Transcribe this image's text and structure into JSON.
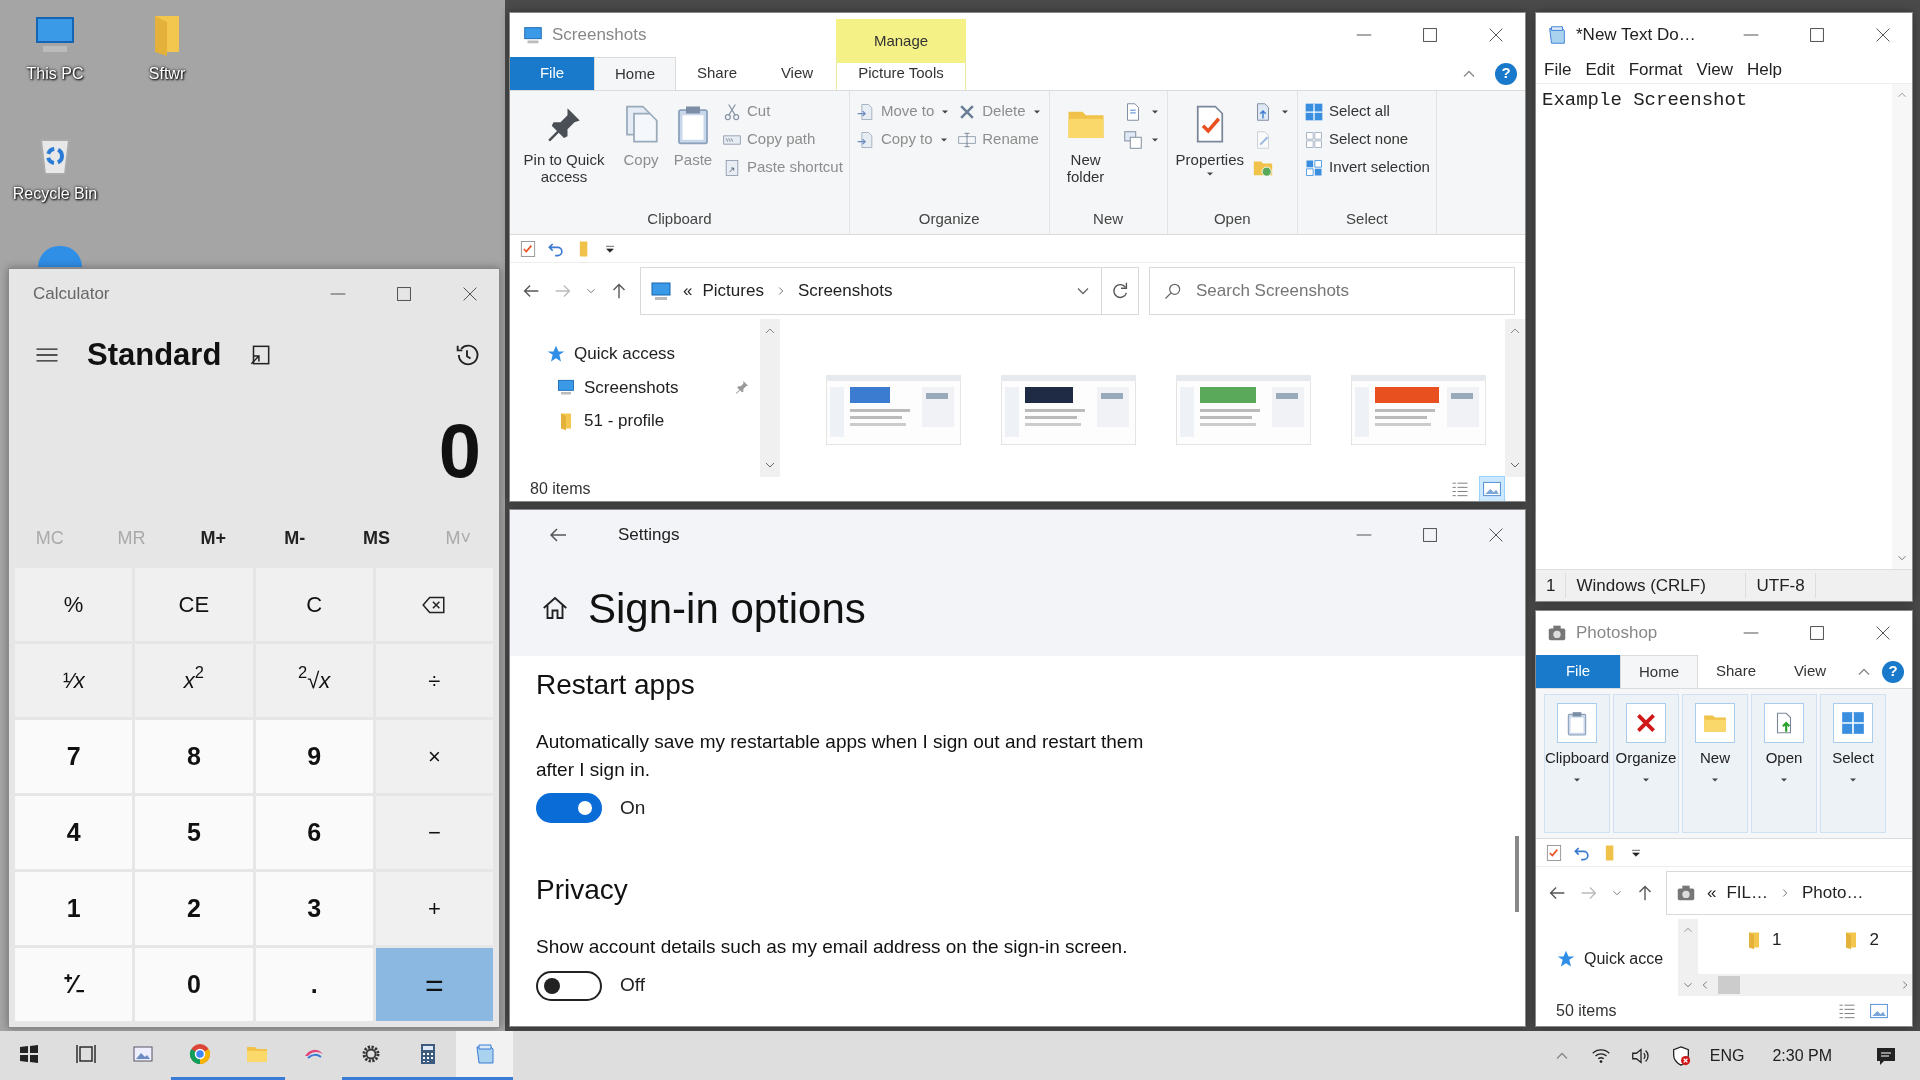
{
  "desktop": {
    "icons": [
      {
        "label": "This PC",
        "kind": "pc"
      },
      {
        "label": "Sftwr",
        "kind": "folder"
      },
      {
        "label": "Recycle Bin",
        "kind": "bin"
      }
    ]
  },
  "explorer": {
    "title": "Screenshots",
    "context_group": "Manage",
    "help": "?",
    "tabs": [
      {
        "label": "File",
        "kind": "file",
        "selected": false
      },
      {
        "label": "Home",
        "kind": "tab",
        "selected": true
      },
      {
        "label": "Share",
        "kind": "tab",
        "selected": false
      },
      {
        "label": "View",
        "kind": "tab",
        "selected": false
      },
      {
        "label": "Picture Tools",
        "kind": "context",
        "selected": false
      }
    ],
    "ribbon_groups": [
      {
        "label": "Clipboard",
        "columns": [
          [
            {
              "label": "Pin to Quick access",
              "kind": "large",
              "disabled": false,
              "dropdown": false
            }
          ],
          [
            {
              "label": "Copy",
              "kind": "large",
              "disabled": true,
              "dropdown": false
            }
          ],
          [
            {
              "label": "Paste",
              "kind": "large",
              "disabled": true,
              "dropdown": false
            }
          ],
          [
            {
              "label": "Cut",
              "kind": "small",
              "disabled": true,
              "dropdown": false
            },
            {
              "label": "Copy path",
              "kind": "small",
              "disabled": true,
              "dropdown": false
            },
            {
              "label": "Paste shortcut",
              "kind": "small",
              "disabled": true,
              "dropdown": false
            }
          ]
        ]
      },
      {
        "label": "Organize",
        "columns": [
          [
            {
              "label": "Move to",
              "kind": "small",
              "disabled": true,
              "dropdown": true
            },
            {
              "label": "Copy to",
              "kind": "small",
              "disabled": true,
              "dropdown": true
            }
          ],
          [
            {
              "label": "Delete",
              "kind": "small",
              "disabled": true,
              "dropdown": true
            },
            {
              "label": "Rename",
              "kind": "small",
              "disabled": true,
              "dropdown": false
            }
          ]
        ]
      },
      {
        "label": "New",
        "columns": [
          [
            {
              "label": "New folder",
              "kind": "large",
              "disabled": false,
              "dropdown": false
            }
          ],
          [
            {
              "kind": "icon",
              "disabled": false,
              "dropdown": true
            },
            {
              "kind": "icon",
              "disabled": false,
              "dropdown": true
            }
          ]
        ]
      },
      {
        "label": "Open",
        "columns": [
          [
            {
              "label": "Properties",
              "kind": "large",
              "disabled": false,
              "dropdown": true
            }
          ],
          [
            {
              "kind": "icon",
              "disabled": false,
              "dropdown": true
            },
            {
              "kind": "icon",
              "disabled": true,
              "dropdown": false
            },
            {
              "kind": "icon",
              "disabled": false,
              "dropdown": false
            }
          ]
        ]
      },
      {
        "label": "Select",
        "columns": [
          [
            {
              "label": "Select all",
              "kind": "small",
              "disabled": false,
              "dropdown": false
            },
            {
              "label": "Select none",
              "kind": "small",
              "disabled": false,
              "dropdown": false
            },
            {
              "label": "Invert selection",
              "kind": "small",
              "disabled": false,
              "dropdown": false
            }
          ]
        ]
      }
    ],
    "address": {
      "overflow": "«",
      "parts": [
        "Pictures",
        "Screenshots"
      ]
    },
    "search": {
      "placeholder": "Search Screenshots"
    },
    "nav": [
      {
        "label": "Quick access",
        "pinned": false
      },
      {
        "label": "Screenshots",
        "pinned": true
      },
      {
        "label": "51 - profile",
        "pinned": false
      }
    ],
    "status": "80 items",
    "views": [
      {
        "kind": "details",
        "selected": false
      },
      {
        "kind": "large",
        "selected": true
      }
    ]
  },
  "calculator": {
    "title": "Calculator",
    "mode": "Standard",
    "display": "0",
    "memory": [
      {
        "label": "MC",
        "disabled": true
      },
      {
        "label": "MR",
        "disabled": true
      },
      {
        "label": "M+",
        "disabled": false
      },
      {
        "label": "M-",
        "disabled": false
      },
      {
        "label": "MS",
        "disabled": false
      },
      {
        "label": "M˅",
        "disabled": true
      }
    ],
    "keys": [
      {
        "label": "%",
        "kind": "function"
      },
      {
        "label": "CE",
        "kind": "function"
      },
      {
        "label": "C",
        "kind": "function"
      },
      {
        "kind": "backspace"
      },
      {
        "label": "¹⁄*x*",
        "kind": "function"
      },
      {
        "label": "*x*$^{2}$",
        "kind": "function"
      },
      {
        "label": "$^{2}$√*x*",
        "kind": "function"
      },
      {
        "label": "÷",
        "kind": "function"
      },
      {
        "label": "7",
        "kind": "number"
      },
      {
        "label": "8",
        "kind": "number"
      },
      {
        "label": "9",
        "kind": "number"
      },
      {
        "label": "×",
        "kind": "function"
      },
      {
        "label": "4",
        "kind": "number"
      },
      {
        "label": "5",
        "kind": "number"
      },
      {
        "label": "6",
        "kind": "number"
      },
      {
        "label": "−",
        "kind": "function"
      },
      {
        "label": "1",
        "kind": "number"
      },
      {
        "label": "2",
        "kind": "number"
      },
      {
        "label": "3",
        "kind": "number"
      },
      {
        "label": "+",
        "kind": "function"
      },
      {
        "label": "⁺⁄₋",
        "kind": "number"
      },
      {
        "label": "0",
        "kind": "number"
      },
      {
        "label": ".",
        "kind": "number"
      },
      {
        "label": "=",
        "kind": "equals"
      }
    ]
  },
  "settings": {
    "title": "Settings",
    "heading": "Sign-in options",
    "sections": [
      {
        "title": "Restart apps",
        "description": "Automatically save my restartable apps when I sign out and restart them after I sign in.",
        "toggle": {
          "on": true,
          "label": "On"
        }
      },
      {
        "title": "Privacy",
        "description": "Show account details such as my email address on the sign-in screen.",
        "toggle": {
          "on": false,
          "label": "Off"
        }
      }
    ]
  },
  "notepad": {
    "title": "*New Text Do…",
    "menu": [
      "File",
      "Edit",
      "Format",
      "View",
      "Help"
    ],
    "text": "Example Screenshot",
    "status": [
      "1",
      "Windows (CRLF)",
      "UTF-8"
    ]
  },
  "photoshop": {
    "title": "Photoshop",
    "help": "?",
    "tabs": [
      {
        "label": "File",
        "kind": "file",
        "selected": false
      },
      {
        "label": "Home",
        "kind": "tab",
        "selected": true
      },
      {
        "label": "Share",
        "kind": "tab",
        "selected": false
      },
      {
        "label": "View",
        "kind": "tab",
        "selected": false
      }
    ],
    "ribbon_groups": [
      {
        "label": "Clipboard"
      },
      {
        "label": "Organize"
      },
      {
        "label": "New"
      },
      {
        "label": "Open"
      },
      {
        "label": "Select"
      }
    ],
    "address": {
      "overflow": "«",
      "parts": [
        "FIL…",
        "Photo…"
      ]
    },
    "nav": [
      {
        "label": "Quick acce"
      }
    ],
    "files": [
      {
        "label": "1"
      },
      {
        "label": "2"
      }
    ],
    "status": "50 items",
    "views": [
      {
        "kind": "details",
        "selected": false
      },
      {
        "kind": "large",
        "selected": false
      }
    ]
  },
  "taskbar": {
    "apps": [
      {
        "kind": "start",
        "running": false,
        "active": false
      },
      {
        "kind": "taskview",
        "running": false,
        "active": false
      },
      {
        "kind": "photos",
        "running": false,
        "active": false
      },
      {
        "kind": "browser",
        "running": true,
        "active": false
      },
      {
        "kind": "folder",
        "running": true,
        "active": false
      },
      {
        "kind": "app",
        "running": false,
        "active": false
      },
      {
        "kind": "gear",
        "running": true,
        "active": false
      },
      {
        "kind": "calculator",
        "running": true,
        "active": false
      },
      {
        "kind": "notepad",
        "running": true,
        "active": true
      }
    ],
    "language": "ENG",
    "time": "2:30 PM"
  }
}
